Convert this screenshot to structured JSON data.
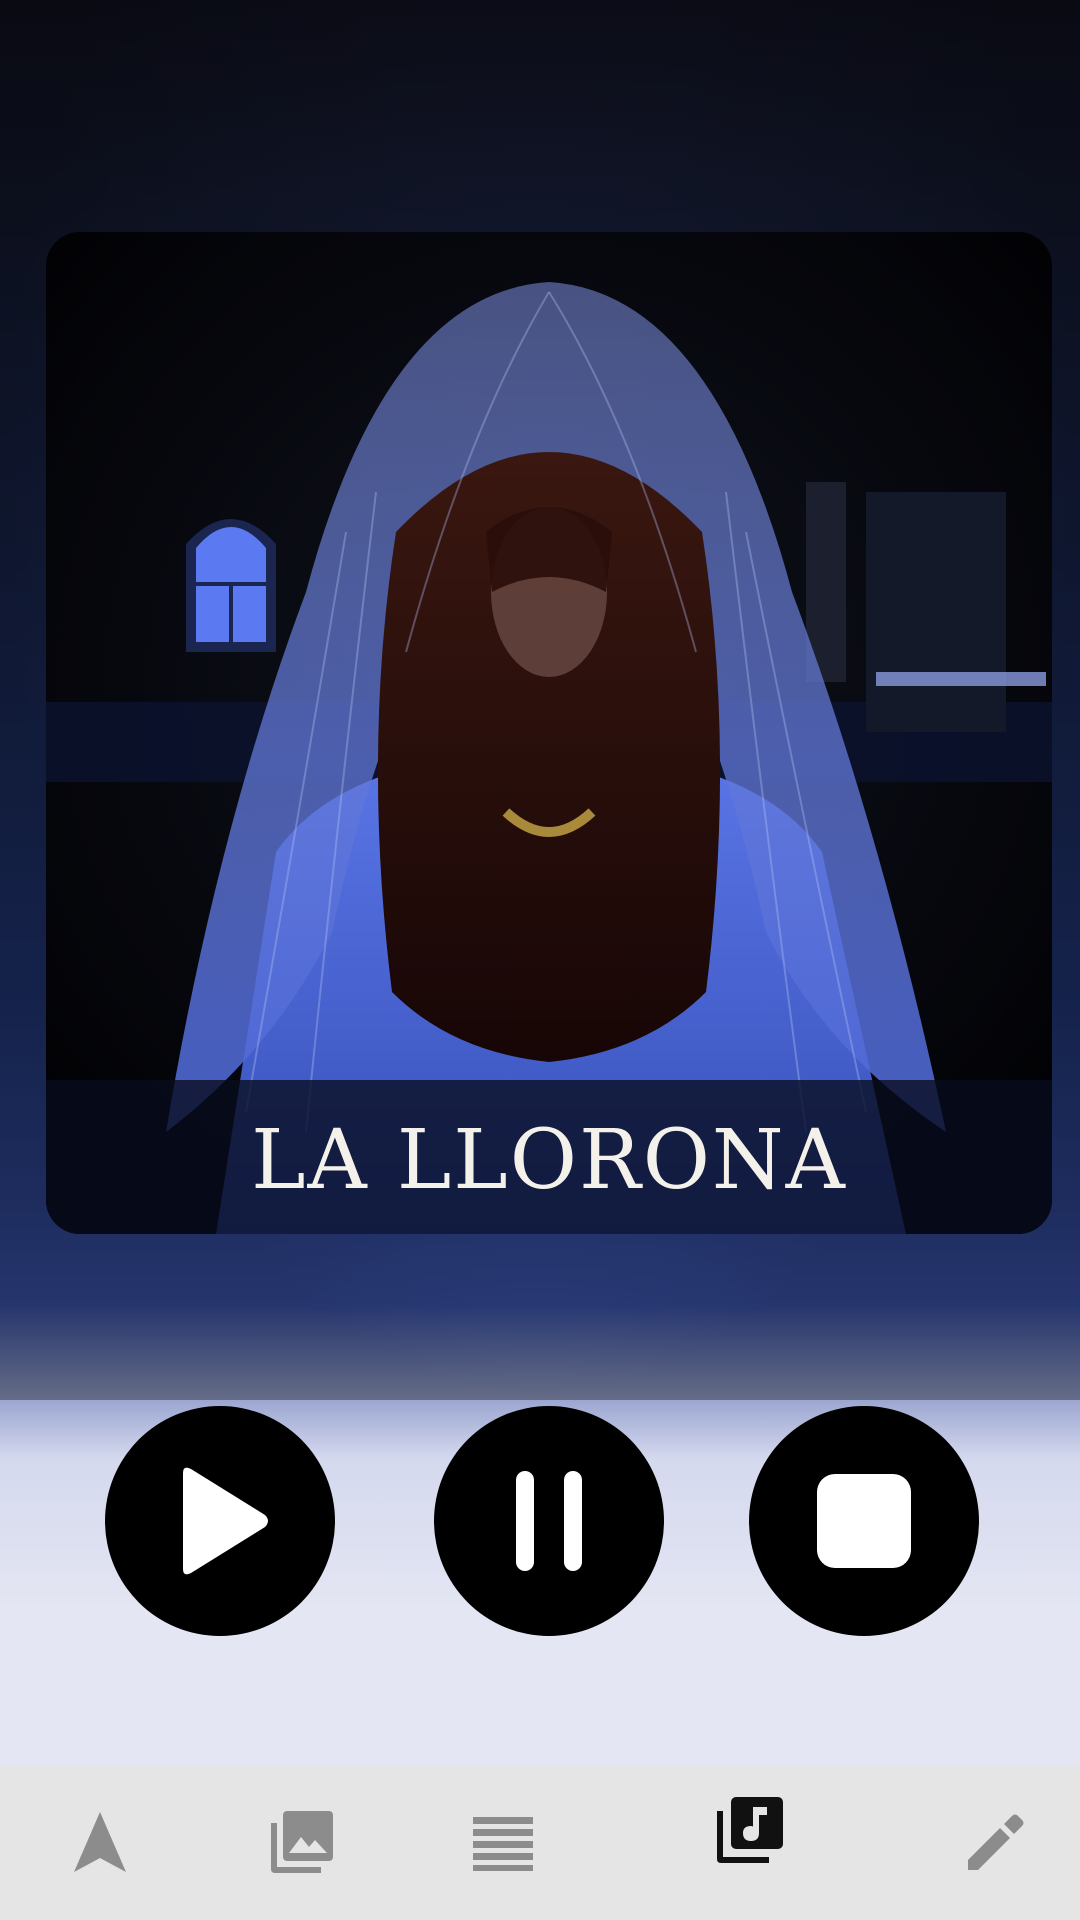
{
  "artwork": {
    "title": "LA LLORONA"
  },
  "controls": [
    {
      "id": "play",
      "icon": "play-icon"
    },
    {
      "id": "pause",
      "icon": "pause-icon"
    },
    {
      "id": "stop",
      "icon": "stop-icon"
    }
  ],
  "bottom_nav": {
    "items": [
      {
        "id": "navigate",
        "icon": "navigation-arrow-icon",
        "active": false
      },
      {
        "id": "gallery",
        "icon": "photo-library-icon",
        "active": false
      },
      {
        "id": "list",
        "icon": "list-icon",
        "active": false
      },
      {
        "id": "music",
        "icon": "music-library-icon",
        "active": true
      },
      {
        "id": "edit",
        "icon": "pencil-icon",
        "active": false
      }
    ],
    "colors": {
      "inactive": "#8c8c8c",
      "active": "#111111",
      "background": "#e5e5e5"
    }
  },
  "colors": {
    "accent": "#3a52a8",
    "control_button": "#000000",
    "title_text": "#f3f1ea"
  }
}
